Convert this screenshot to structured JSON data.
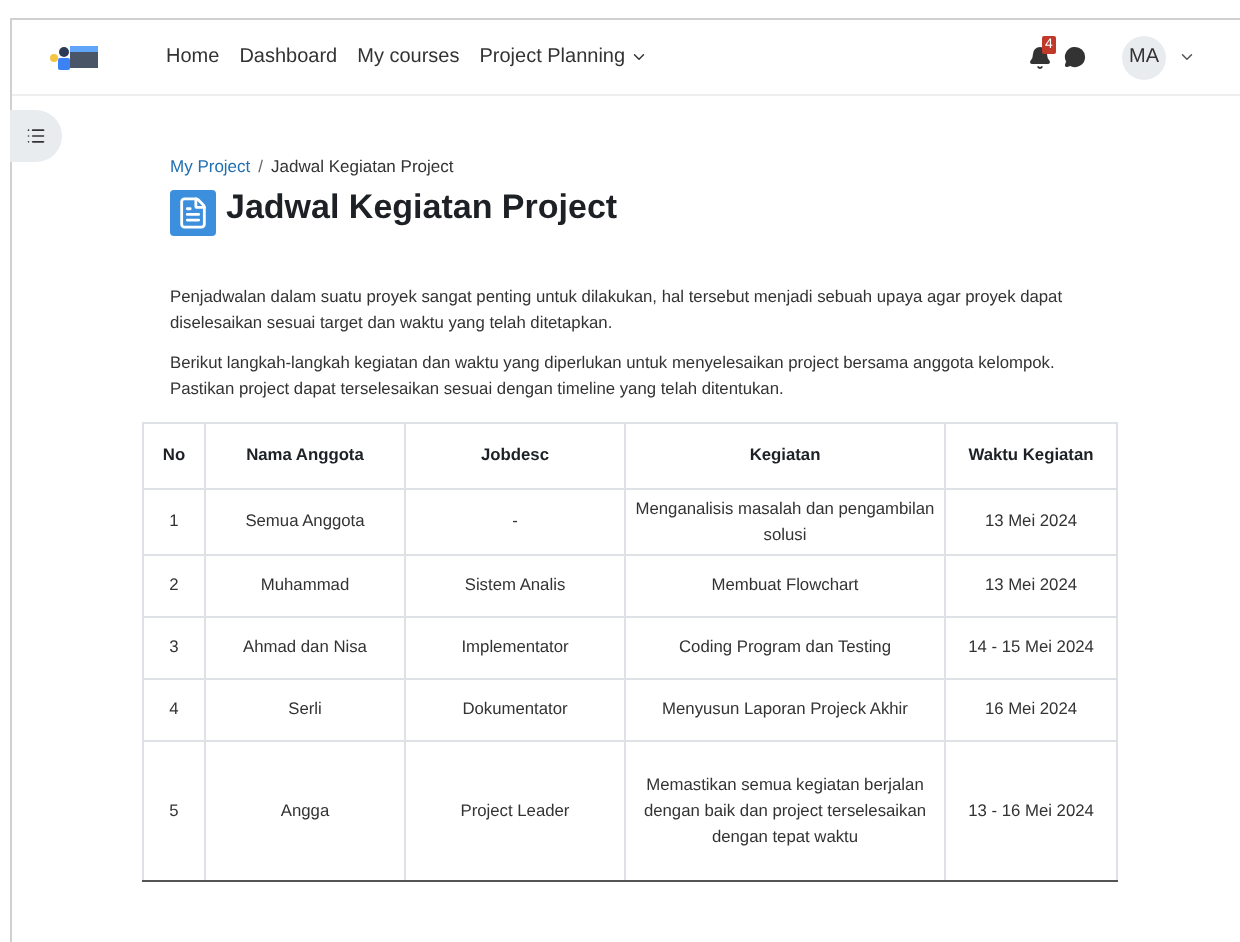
{
  "navbar": {
    "items": [
      {
        "label": "Home",
        "dropdown": false
      },
      {
        "label": "Dashboard",
        "dropdown": false
      },
      {
        "label": "My courses",
        "dropdown": false
      },
      {
        "label": "Project Planning",
        "dropdown": true
      }
    ],
    "notification_count": "4",
    "user_initials": "MA"
  },
  "breadcrumb": {
    "items": [
      "My Project",
      "Jadwal Kegiatan Project"
    ],
    "separator": "/"
  },
  "title": "Jadwal Kegiatan Project",
  "paragraphs": [
    "Penjadwalan dalam suatu proyek sangat penting untuk dilakukan, hal tersebut menjadi sebuah upaya agar proyek dapat diselesaikan sesuai target dan waktu yang telah ditetapkan.",
    "Berikut langkah-langkah kegiatan dan waktu yang diperlukan untuk menyelesaikan project bersama anggota kelompok. Pastikan project dapat terselesaikan sesuai dengan timeline yang telah ditentukan."
  ],
  "table": {
    "columns": [
      "No",
      "Nama Anggota",
      "Jobdesc",
      "Kegiatan",
      "Waktu Kegiatan"
    ],
    "rows": [
      [
        "1",
        "Semua Anggota",
        "-",
        "Menganalisis masalah dan pengambilan solusi",
        "13 Mei 2024"
      ],
      [
        "2",
        "Muhammad",
        "Sistem Analis",
        "Membuat Flowchart",
        "13 Mei 2024"
      ],
      [
        "3",
        "Ahmad dan Nisa",
        "Implementator",
        "Coding Program dan Testing",
        "14 - 15 Mei 2024"
      ],
      [
        "4",
        "Serli",
        "Dokumentator",
        "Menyusun Laporan Projeck Akhir",
        "16 Mei 2024"
      ],
      [
        "5",
        "Angga",
        "Project Leader",
        "Memastikan semua kegiatan berjalan dengan baik dan project terselesaikan dengan tepat waktu",
        "13 - 16 Mei 2024"
      ]
    ]
  }
}
